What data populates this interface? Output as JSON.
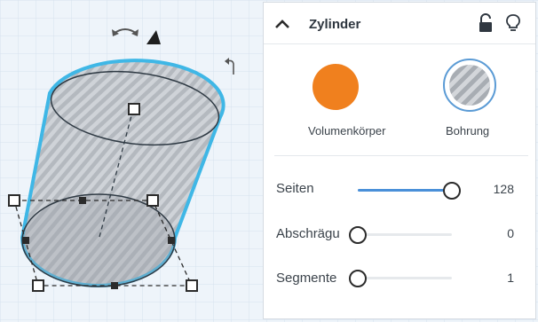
{
  "panel": {
    "title": "Zylinder",
    "solid_label": "Volumenkörper",
    "hole_label": "Bohrung",
    "solid_color": "#f0801e",
    "params": [
      {
        "label": "Seiten",
        "value": "128",
        "level": 1.0
      },
      {
        "label": "Abschrägu",
        "value": "0",
        "level": 0.0
      },
      {
        "label": "Segmente",
        "value": "1",
        "level": 0.0
      }
    ]
  },
  "icons": [
    "rotate-arrow-icon",
    "cone-marker-icon",
    "rotate-vertical-icon",
    "collapse-chevron-icon",
    "lock-icon",
    "lightbulb-icon"
  ],
  "colors": {
    "accent": "#4a90d9",
    "selection_outline": "#3fb7e6"
  }
}
